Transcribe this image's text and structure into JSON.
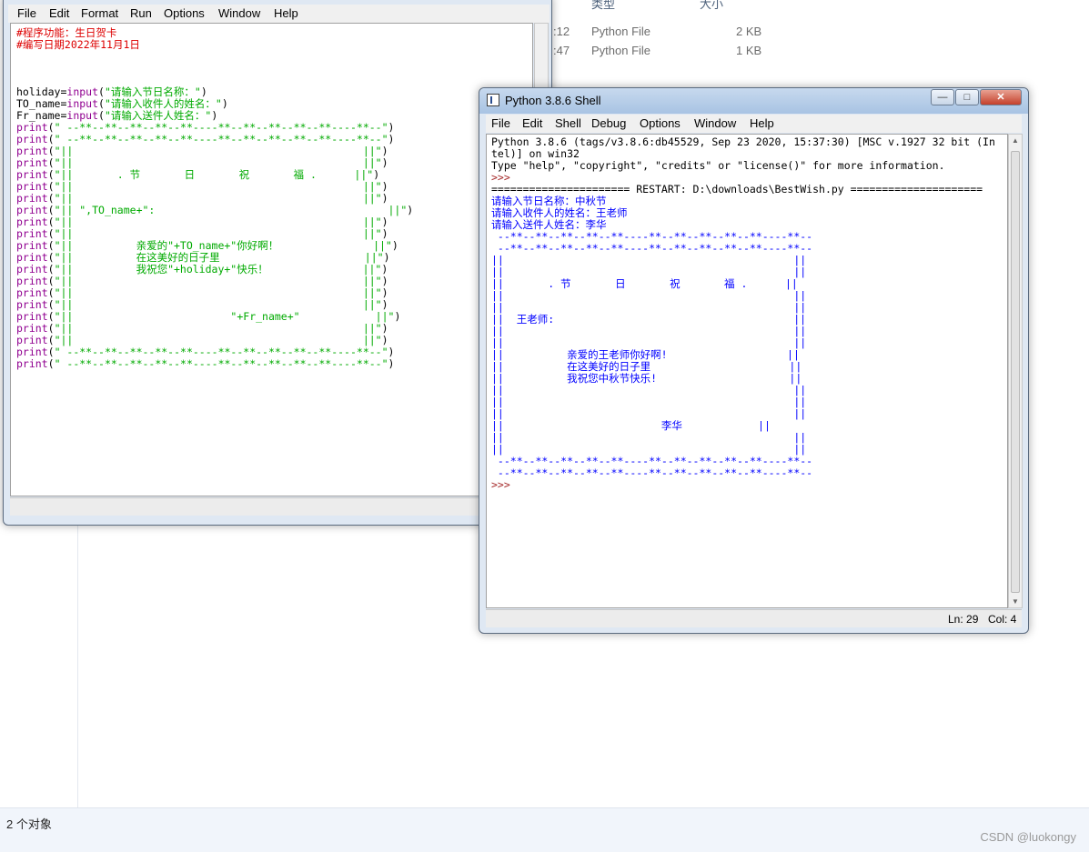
{
  "explorer": {
    "column_headers": [
      "类型",
      "大小"
    ],
    "files": [
      {
        "time": ":12",
        "type": "Python File",
        "size": "2 KB"
      },
      {
        "time": ":47",
        "type": "Python File",
        "size": "1 KB"
      }
    ],
    "status_text": "2 个对象",
    "watermark": "CSDN @luokongy"
  },
  "editor": {
    "menu": [
      "File",
      "Edit",
      "Format",
      "Run",
      "Options",
      "Window",
      "Help"
    ],
    "code_lines": [
      {
        "parts": [
          [
            "comment",
            "#程序功能：生日贺卡"
          ]
        ]
      },
      {
        "parts": [
          [
            "comment",
            "#编写日期2022年11月1日"
          ]
        ]
      },
      {
        "parts": [
          [
            "plain",
            ""
          ]
        ]
      },
      {
        "parts": [
          [
            "plain",
            ""
          ]
        ]
      },
      {
        "parts": [
          [
            "plain",
            ""
          ]
        ]
      },
      {
        "parts": [
          [
            "plain",
            "holiday="
          ],
          [
            "kw",
            "input"
          ],
          [
            "plain",
            "("
          ],
          [
            "str",
            "\"请输入节日名称：\""
          ],
          [
            "plain",
            ")"
          ]
        ]
      },
      {
        "parts": [
          [
            "plain",
            "TO_name="
          ],
          [
            "kw",
            "input"
          ],
          [
            "plain",
            "("
          ],
          [
            "str",
            "\"请输入收件人的姓名：\""
          ],
          [
            "plain",
            ")"
          ]
        ]
      },
      {
        "parts": [
          [
            "plain",
            "Fr_name="
          ],
          [
            "kw",
            "input"
          ],
          [
            "plain",
            "("
          ],
          [
            "str",
            "\"请输入送件人姓名：\""
          ],
          [
            "plain",
            ")"
          ]
        ]
      },
      {
        "parts": [
          [
            "kw",
            "print"
          ],
          [
            "plain",
            "("
          ],
          [
            "str",
            "\" --**--**--**--**--**----**--**--**--**--**----**--\""
          ],
          [
            "plain",
            ")"
          ]
        ]
      },
      {
        "parts": [
          [
            "kw",
            "print"
          ],
          [
            "plain",
            "("
          ],
          [
            "str",
            "\" --**--**--**--**--**----**--**--**--**--**----**--\""
          ],
          [
            "plain",
            ")"
          ]
        ]
      },
      {
        "parts": [
          [
            "kw",
            "print"
          ],
          [
            "plain",
            "("
          ],
          [
            "str",
            "\"||                                              ||\""
          ],
          [
            "plain",
            ")"
          ]
        ]
      },
      {
        "parts": [
          [
            "kw",
            "print"
          ],
          [
            "plain",
            "("
          ],
          [
            "str",
            "\"||                                              ||\""
          ],
          [
            "plain",
            ")"
          ]
        ]
      },
      {
        "parts": [
          [
            "kw",
            "print"
          ],
          [
            "plain",
            "("
          ],
          [
            "str",
            "\"||       . 节       日       祝       福 .      ||\""
          ],
          [
            "plain",
            ")"
          ]
        ]
      },
      {
        "parts": [
          [
            "kw",
            "print"
          ],
          [
            "plain",
            "("
          ],
          [
            "str",
            "\"||                                              ||\""
          ],
          [
            "plain",
            ")"
          ]
        ]
      },
      {
        "parts": [
          [
            "kw",
            "print"
          ],
          [
            "plain",
            "("
          ],
          [
            "str",
            "\"||                                              ||\""
          ],
          [
            "plain",
            ")"
          ]
        ]
      },
      {
        "parts": [
          [
            "kw",
            "print"
          ],
          [
            "plain",
            "("
          ],
          [
            "str",
            "\"|| \",TO_name+\":                                     ||\""
          ],
          [
            "plain",
            ")"
          ]
        ]
      },
      {
        "parts": [
          [
            "kw",
            "print"
          ],
          [
            "plain",
            "("
          ],
          [
            "str",
            "\"||                                              ||\""
          ],
          [
            "plain",
            ")"
          ]
        ]
      },
      {
        "parts": [
          [
            "kw",
            "print"
          ],
          [
            "plain",
            "("
          ],
          [
            "str",
            "\"||                                              ||\""
          ],
          [
            "plain",
            ")"
          ]
        ]
      },
      {
        "parts": [
          [
            "kw",
            "print"
          ],
          [
            "plain",
            "("
          ],
          [
            "str",
            "\"||          亲爱的\"+TO_name+\"你好啊！               ||\""
          ],
          [
            "plain",
            ")"
          ]
        ]
      },
      {
        "parts": [
          [
            "kw",
            "print"
          ],
          [
            "plain",
            "("
          ],
          [
            "str",
            "\"||          在这美好的日子里                       ||\""
          ],
          [
            "plain",
            ")"
          ]
        ]
      },
      {
        "parts": [
          [
            "kw",
            "print"
          ],
          [
            "plain",
            "("
          ],
          [
            "str",
            "\"||          我祝您\"+holiday+\"快乐！               ||\""
          ],
          [
            "plain",
            ")"
          ]
        ]
      },
      {
        "parts": [
          [
            "kw",
            "print"
          ],
          [
            "plain",
            "("
          ],
          [
            "str",
            "\"||                                              ||\""
          ],
          [
            "plain",
            ")"
          ]
        ]
      },
      {
        "parts": [
          [
            "kw",
            "print"
          ],
          [
            "plain",
            "("
          ],
          [
            "str",
            "\"||                                              ||\""
          ],
          [
            "plain",
            ")"
          ]
        ]
      },
      {
        "parts": [
          [
            "kw",
            "print"
          ],
          [
            "plain",
            "("
          ],
          [
            "str",
            "\"||                                              ||\""
          ],
          [
            "plain",
            ")"
          ]
        ]
      },
      {
        "parts": [
          [
            "kw",
            "print"
          ],
          [
            "plain",
            "("
          ],
          [
            "str",
            "\"||                         \"+Fr_name+\"            ||\""
          ],
          [
            "plain",
            ")"
          ]
        ]
      },
      {
        "parts": [
          [
            "kw",
            "print"
          ],
          [
            "plain",
            "("
          ],
          [
            "str",
            "\"||                                              ||\""
          ],
          [
            "plain",
            ")"
          ]
        ]
      },
      {
        "parts": [
          [
            "kw",
            "print"
          ],
          [
            "plain",
            "("
          ],
          [
            "str",
            "\"||                                              ||\""
          ],
          [
            "plain",
            ")"
          ]
        ]
      },
      {
        "parts": [
          [
            "kw",
            "print"
          ],
          [
            "plain",
            "("
          ],
          [
            "str",
            "\" --**--**--**--**--**----**--**--**--**--**----**--\""
          ],
          [
            "plain",
            ")"
          ]
        ]
      },
      {
        "parts": [
          [
            "kw",
            "print"
          ],
          [
            "plain",
            "("
          ],
          [
            "str",
            "\" --**--**--**--**--**----**--**--**--**--**----**--\""
          ],
          [
            "plain",
            ")"
          ]
        ]
      }
    ]
  },
  "shell": {
    "title": "Python 3.8.6 Shell",
    "buttons": {
      "minimize": "—",
      "maximize": "□",
      "close": "✕"
    },
    "menu": [
      "File",
      "Edit",
      "Shell",
      "Debug",
      "Options",
      "Window",
      "Help"
    ],
    "lines": [
      {
        "c": "black",
        "t": "Python 3.8.6 (tags/v3.8.6:db45529, Sep 23 2020, 15:37:30) [MSC v.1927 32 bit (In"
      },
      {
        "c": "black",
        "t": "tel)] on win32"
      },
      {
        "c": "black",
        "t": "Type \"help\", \"copyright\", \"credits\" or \"license()\" for more information."
      },
      {
        "c": "darkred",
        "t": ">>> "
      },
      {
        "c": "black",
        "t": "====================== RESTART: D:\\downloads\\BestWish.py ====================="
      },
      {
        "c": "blue",
        "t": "请输入节日名称：中秋节"
      },
      {
        "c": "blue",
        "t": "请输入收件人的姓名：王老师"
      },
      {
        "c": "blue",
        "t": "请输入送件人姓名：李华"
      },
      {
        "c": "blue",
        "t": " --**--**--**--**--**----**--**--**--**--**----**--"
      },
      {
        "c": "blue",
        "t": " --**--**--**--**--**----**--**--**--**--**----**--"
      },
      {
        "c": "blue",
        "t": "||                                              ||"
      },
      {
        "c": "blue",
        "t": "||                                              ||"
      },
      {
        "c": "blue",
        "t": "||       . 节       日       祝       福 .      ||"
      },
      {
        "c": "blue",
        "t": "||                                              ||"
      },
      {
        "c": "blue",
        "t": "||                                              ||"
      },
      {
        "c": "blue",
        "t": "||  王老师:                                      ||"
      },
      {
        "c": "blue",
        "t": "||                                              ||"
      },
      {
        "c": "blue",
        "t": "||                                              ||"
      },
      {
        "c": "blue",
        "t": "||          亲爱的王老师你好啊!                   ||"
      },
      {
        "c": "blue",
        "t": "||          在这美好的日子里                      ||"
      },
      {
        "c": "blue",
        "t": "||          我祝您中秋节快乐!                     ||"
      },
      {
        "c": "blue",
        "t": "||                                              ||"
      },
      {
        "c": "blue",
        "t": "||                                              ||"
      },
      {
        "c": "blue",
        "t": "||                                              ||"
      },
      {
        "c": "blue",
        "t": "||                         李华            ||"
      },
      {
        "c": "blue",
        "t": "||                                              ||"
      },
      {
        "c": "blue",
        "t": "||                                              ||"
      },
      {
        "c": "blue",
        "t": " --**--**--**--**--**----**--**--**--**--**----**--"
      },
      {
        "c": "blue",
        "t": " --**--**--**--**--**----**--**--**--**--**----**--"
      },
      {
        "c": "darkred",
        "t": ">>> "
      }
    ],
    "status": {
      "ln": "Ln: 29",
      "col": "Col: 4"
    }
  }
}
